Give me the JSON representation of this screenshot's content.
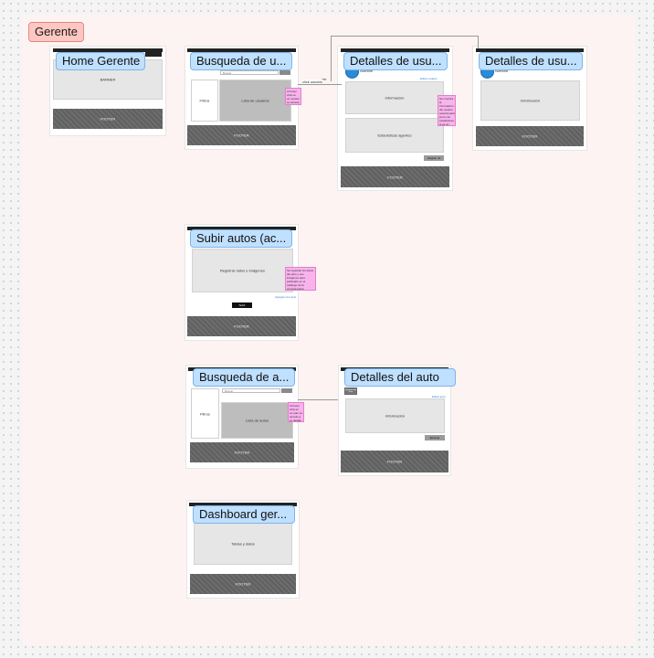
{
  "section": {
    "label": "Gerente",
    "color": "#ffc7c2"
  },
  "frames": {
    "home": {
      "title": "Home Gerente",
      "banner": "BANNER",
      "footer": "FOOTER"
    },
    "busqueda_usuarios": {
      "title": "Busqueda de u...",
      "filters": "Filtros",
      "search_placeholder": "Buscar",
      "results": "Lista de usuarios",
      "footer": "FOOTER",
      "note": "Al hacer click en un usuario se accede a su detalle"
    },
    "detalles_usuario_1": {
      "title": "Detalles de usu...",
      "user_name": "Nombre",
      "info": "Información",
      "stats": "Estadísticas agentes",
      "button": "Asignar rol",
      "link": "Editar usuario",
      "footer": "FOOTER",
      "note": "Se muestra la información del usuario seleccionado junto con estadísticas si es un agente"
    },
    "detalles_usuario_2": {
      "title": "Detalles de usu...",
      "user_name": "Nombre",
      "info": "Información",
      "footer": "FOOTER"
    },
    "subir_autos": {
      "title": "Subir autos (ac...",
      "form": "Registrar datos e imágenes",
      "link": "Agregar otro auto",
      "button": "Subir",
      "footer": "FOOTER",
      "note": "Se registran los datos del auto y sus imágenes para publicarlo en el catálogo de la concesionaria"
    },
    "busqueda_autos": {
      "title": "Busqueda de a...",
      "filters": "Filtros",
      "search_placeholder": "Buscar",
      "results": "Lista de autos",
      "footer": "FOOTER",
      "note": "Al hacer click en un auto se accede a su detalle"
    },
    "detalles_auto": {
      "title": "Detalles del auto",
      "images": "Imágenes del auto",
      "info": "Información",
      "link": "Editar auto",
      "button": "Eliminar",
      "footer": "FOOTER"
    },
    "dashboard": {
      "title": "Dashboard ger...",
      "content": "Tablas y datos",
      "footer": "FOOTER"
    }
  },
  "connectors": {
    "label_1": "ver",
    "label_2": "click usuario"
  }
}
